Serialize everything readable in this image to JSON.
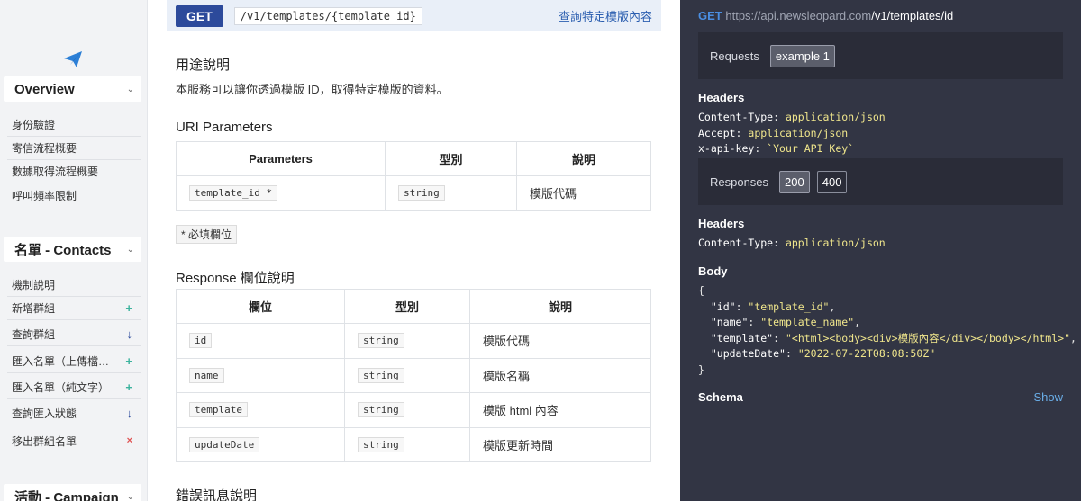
{
  "sidebar": {
    "sections": [
      {
        "title": "Overview",
        "items": [
          {
            "label": "身份驗證",
            "marker": ""
          },
          {
            "label": "寄信流程概要",
            "marker": ""
          },
          {
            "label": "數據取得流程概要",
            "marker": ""
          },
          {
            "label": "呼叫頻率限制",
            "marker": ""
          }
        ]
      },
      {
        "title": "名單 - Contacts",
        "items": [
          {
            "label": "機制說明",
            "marker": ""
          },
          {
            "label": "新增群組",
            "marker": "+"
          },
          {
            "label": "查詢群組",
            "marker": "↓"
          },
          {
            "label": "匯入名單（上傳檔案）",
            "marker": "+"
          },
          {
            "label": "匯入名單（純文字）",
            "marker": "+"
          },
          {
            "label": "查詢匯入狀態",
            "marker": "↓"
          },
          {
            "label": "移出群組名單",
            "marker": "×"
          }
        ]
      },
      {
        "title": "活動 - Campaign",
        "items": []
      }
    ],
    "colors": {
      "add": "#3db39e",
      "get": "#2c4a9b",
      "delete": "#e05252"
    }
  },
  "endpoint": {
    "method": "GET",
    "path": "/v1/templates/{template_id}",
    "title": "查詢特定模版內容"
  },
  "usage": {
    "heading": "用途說明",
    "text": "本服務可以讓你透過模版 ID，取得特定模版的資料。"
  },
  "uri_params": {
    "heading": "URI Parameters",
    "columns": [
      "Parameters",
      "型別",
      "說明"
    ],
    "rows": [
      {
        "name": "template_id *",
        "type": "string",
        "desc": "模版代碼"
      }
    ],
    "required_note": "* 必填欄位"
  },
  "response_fields": {
    "heading": "Response 欄位說明",
    "columns": [
      "欄位",
      "型別",
      "說明"
    ],
    "rows": [
      {
        "name": "id",
        "type": "string",
        "desc": "模版代碼"
      },
      {
        "name": "name",
        "type": "string",
        "desc": "模版名稱"
      },
      {
        "name": "template",
        "type": "string",
        "desc": "模版 html 內容"
      },
      {
        "name": "updateDate",
        "type": "string",
        "desc": "模版更新時間"
      }
    ]
  },
  "errors": {
    "heading": "錯誤訊息說明"
  },
  "panel": {
    "method": "GET",
    "base_url": "https://api.newsleopard.com",
    "path": "/v1/templates/id",
    "requests_label": "Requests",
    "request_examples": [
      "example 1"
    ],
    "headers_label": "Headers",
    "request_headers": [
      {
        "key": "Content-Type",
        "value": "application/json"
      },
      {
        "key": "Accept",
        "value": "application/json"
      },
      {
        "key": "x-api-key",
        "value": "`Your API Key`"
      }
    ],
    "responses_label": "Responses",
    "response_codes": [
      "200",
      "400"
    ],
    "response_headers_label": "Headers",
    "response_headers": [
      {
        "key": "Content-Type",
        "value": "application/json"
      }
    ],
    "body_label": "Body",
    "body": {
      "open": "{",
      "lines": [
        {
          "key": "\"id\"",
          "value": "\"template_id\"",
          "comma": ","
        },
        {
          "key": "\"name\"",
          "value": "\"template_name\"",
          "comma": ","
        },
        {
          "key": "\"template\"",
          "value": "\"<html><body><div>模版內容</div></body></html>\"",
          "comma": ","
        },
        {
          "key": "\"updateDate\"",
          "value": "\"2022-07-22T08:08:50Z\"",
          "comma": ""
        }
      ],
      "close": "}"
    },
    "schema_label": "Schema",
    "show_label": "Show"
  }
}
